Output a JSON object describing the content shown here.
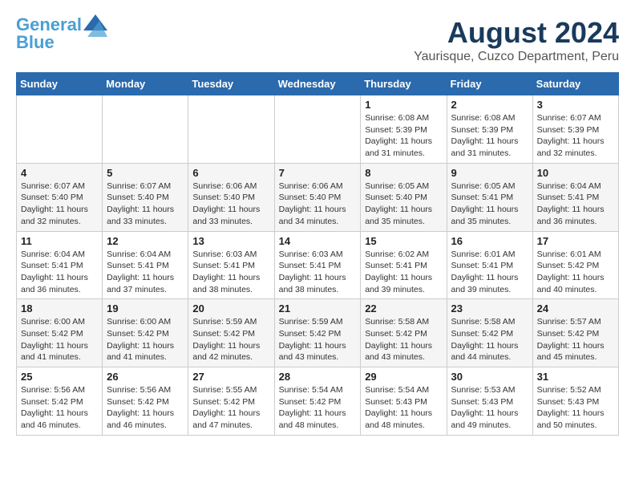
{
  "logo": {
    "line1": "General",
    "line2": "Blue"
  },
  "title": "August 2024",
  "subtitle": "Yaurisque, Cuzco Department, Peru",
  "weekdays": [
    "Sunday",
    "Monday",
    "Tuesday",
    "Wednesday",
    "Thursday",
    "Friday",
    "Saturday"
  ],
  "weeks": [
    [
      {
        "day": "",
        "detail": ""
      },
      {
        "day": "",
        "detail": ""
      },
      {
        "day": "",
        "detail": ""
      },
      {
        "day": "",
        "detail": ""
      },
      {
        "day": "1",
        "detail": "Sunrise: 6:08 AM\nSunset: 5:39 PM\nDaylight: 11 hours and 31 minutes."
      },
      {
        "day": "2",
        "detail": "Sunrise: 6:08 AM\nSunset: 5:39 PM\nDaylight: 11 hours and 31 minutes."
      },
      {
        "day": "3",
        "detail": "Sunrise: 6:07 AM\nSunset: 5:39 PM\nDaylight: 11 hours and 32 minutes."
      }
    ],
    [
      {
        "day": "4",
        "detail": "Sunrise: 6:07 AM\nSunset: 5:40 PM\nDaylight: 11 hours and 32 minutes."
      },
      {
        "day": "5",
        "detail": "Sunrise: 6:07 AM\nSunset: 5:40 PM\nDaylight: 11 hours and 33 minutes."
      },
      {
        "day": "6",
        "detail": "Sunrise: 6:06 AM\nSunset: 5:40 PM\nDaylight: 11 hours and 33 minutes."
      },
      {
        "day": "7",
        "detail": "Sunrise: 6:06 AM\nSunset: 5:40 PM\nDaylight: 11 hours and 34 minutes."
      },
      {
        "day": "8",
        "detail": "Sunrise: 6:05 AM\nSunset: 5:40 PM\nDaylight: 11 hours and 35 minutes."
      },
      {
        "day": "9",
        "detail": "Sunrise: 6:05 AM\nSunset: 5:41 PM\nDaylight: 11 hours and 35 minutes."
      },
      {
        "day": "10",
        "detail": "Sunrise: 6:04 AM\nSunset: 5:41 PM\nDaylight: 11 hours and 36 minutes."
      }
    ],
    [
      {
        "day": "11",
        "detail": "Sunrise: 6:04 AM\nSunset: 5:41 PM\nDaylight: 11 hours and 36 minutes."
      },
      {
        "day": "12",
        "detail": "Sunrise: 6:04 AM\nSunset: 5:41 PM\nDaylight: 11 hours and 37 minutes."
      },
      {
        "day": "13",
        "detail": "Sunrise: 6:03 AM\nSunset: 5:41 PM\nDaylight: 11 hours and 38 minutes."
      },
      {
        "day": "14",
        "detail": "Sunrise: 6:03 AM\nSunset: 5:41 PM\nDaylight: 11 hours and 38 minutes."
      },
      {
        "day": "15",
        "detail": "Sunrise: 6:02 AM\nSunset: 5:41 PM\nDaylight: 11 hours and 39 minutes."
      },
      {
        "day": "16",
        "detail": "Sunrise: 6:01 AM\nSunset: 5:41 PM\nDaylight: 11 hours and 39 minutes."
      },
      {
        "day": "17",
        "detail": "Sunrise: 6:01 AM\nSunset: 5:42 PM\nDaylight: 11 hours and 40 minutes."
      }
    ],
    [
      {
        "day": "18",
        "detail": "Sunrise: 6:00 AM\nSunset: 5:42 PM\nDaylight: 11 hours and 41 minutes."
      },
      {
        "day": "19",
        "detail": "Sunrise: 6:00 AM\nSunset: 5:42 PM\nDaylight: 11 hours and 41 minutes."
      },
      {
        "day": "20",
        "detail": "Sunrise: 5:59 AM\nSunset: 5:42 PM\nDaylight: 11 hours and 42 minutes."
      },
      {
        "day": "21",
        "detail": "Sunrise: 5:59 AM\nSunset: 5:42 PM\nDaylight: 11 hours and 43 minutes."
      },
      {
        "day": "22",
        "detail": "Sunrise: 5:58 AM\nSunset: 5:42 PM\nDaylight: 11 hours and 43 minutes."
      },
      {
        "day": "23",
        "detail": "Sunrise: 5:58 AM\nSunset: 5:42 PM\nDaylight: 11 hours and 44 minutes."
      },
      {
        "day": "24",
        "detail": "Sunrise: 5:57 AM\nSunset: 5:42 PM\nDaylight: 11 hours and 45 minutes."
      }
    ],
    [
      {
        "day": "25",
        "detail": "Sunrise: 5:56 AM\nSunset: 5:42 PM\nDaylight: 11 hours and 46 minutes."
      },
      {
        "day": "26",
        "detail": "Sunrise: 5:56 AM\nSunset: 5:42 PM\nDaylight: 11 hours and 46 minutes."
      },
      {
        "day": "27",
        "detail": "Sunrise: 5:55 AM\nSunset: 5:42 PM\nDaylight: 11 hours and 47 minutes."
      },
      {
        "day": "28",
        "detail": "Sunrise: 5:54 AM\nSunset: 5:42 PM\nDaylight: 11 hours and 48 minutes."
      },
      {
        "day": "29",
        "detail": "Sunrise: 5:54 AM\nSunset: 5:43 PM\nDaylight: 11 hours and 48 minutes."
      },
      {
        "day": "30",
        "detail": "Sunrise: 5:53 AM\nSunset: 5:43 PM\nDaylight: 11 hours and 49 minutes."
      },
      {
        "day": "31",
        "detail": "Sunrise: 5:52 AM\nSunset: 5:43 PM\nDaylight: 11 hours and 50 minutes."
      }
    ]
  ]
}
